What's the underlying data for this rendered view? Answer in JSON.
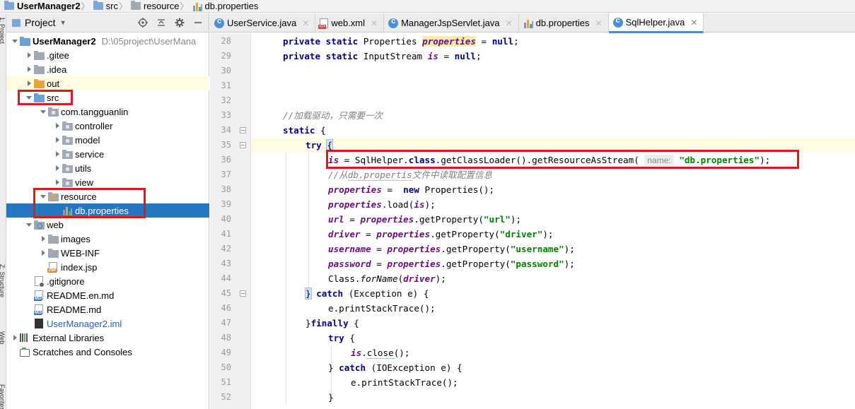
{
  "breadcrumb": {
    "items": [
      {
        "label": "UserManager2",
        "icon": "project-folder-icon",
        "bold": true
      },
      {
        "label": "src",
        "icon": "folder-icon"
      },
      {
        "label": "resource",
        "icon": "resource-folder-icon"
      },
      {
        "label": "db.properties",
        "icon": "properties-file-icon"
      }
    ]
  },
  "left_strip": {
    "labels": [
      "1: Project",
      "Z: Structure",
      "Web",
      "Favorites"
    ]
  },
  "project_panel": {
    "title": "Project",
    "tree": [
      {
        "label": "UserManager2",
        "path": "D:\\05project\\UserMana",
        "depth": 0,
        "state": "open",
        "icon": "module",
        "bold": true
      },
      {
        "label": ".gitee",
        "depth": 1,
        "state": "closed",
        "icon": "folder"
      },
      {
        "label": ".idea",
        "depth": 1,
        "state": "closed",
        "icon": "folder"
      },
      {
        "label": "out",
        "depth": 1,
        "state": "closed",
        "icon": "folder-orange",
        "highlight": true
      },
      {
        "label": "src",
        "depth": 1,
        "state": "open",
        "icon": "folder-src"
      },
      {
        "label": "com.tangguanlin",
        "depth": 2,
        "state": "open",
        "icon": "package"
      },
      {
        "label": "controller",
        "depth": 3,
        "state": "closed",
        "icon": "package"
      },
      {
        "label": "model",
        "depth": 3,
        "state": "closed",
        "icon": "package"
      },
      {
        "label": "service",
        "depth": 3,
        "state": "closed",
        "icon": "package"
      },
      {
        "label": "utils",
        "depth": 3,
        "state": "closed",
        "icon": "package"
      },
      {
        "label": "view",
        "depth": 3,
        "state": "closed",
        "icon": "package"
      },
      {
        "label": "resource",
        "depth": 2,
        "state": "open",
        "icon": "resource"
      },
      {
        "label": "db.properties",
        "depth": 3,
        "state": "none",
        "icon": "properties",
        "selected": true
      },
      {
        "label": "web",
        "depth": 1,
        "state": "open",
        "icon": "web"
      },
      {
        "label": "images",
        "depth": 2,
        "state": "closed",
        "icon": "folder"
      },
      {
        "label": "WEB-INF",
        "depth": 2,
        "state": "closed",
        "icon": "folder"
      },
      {
        "label": "index.jsp",
        "depth": 2,
        "state": "none",
        "icon": "jsp"
      },
      {
        "label": ".gitignore",
        "depth": 1,
        "state": "none",
        "icon": "gitignore"
      },
      {
        "label": "README.en.md",
        "depth": 1,
        "state": "none",
        "icon": "md"
      },
      {
        "label": "README.md",
        "depth": 1,
        "state": "none",
        "icon": "md"
      },
      {
        "label": "UserManager2.iml",
        "depth": 1,
        "state": "none",
        "icon": "iml",
        "blue": true
      },
      {
        "label": "External Libraries",
        "depth": 0,
        "state": "closed",
        "icon": "libraries"
      },
      {
        "label": "Scratches and Consoles",
        "depth": 0,
        "state": "none",
        "icon": "scratches"
      }
    ]
  },
  "editor": {
    "tabs": [
      {
        "label": "UserService.java",
        "icon": "java-class-icon",
        "active": false
      },
      {
        "label": "web.xml",
        "icon": "xml-file-icon",
        "active": false
      },
      {
        "label": "ManagerJspServlet.java",
        "icon": "java-class-icon",
        "active": false
      },
      {
        "label": "db.properties",
        "icon": "properties-file-icon",
        "active": false
      },
      {
        "label": "SqlHelper.java",
        "icon": "java-class-icon",
        "active": true
      }
    ],
    "param_hint": "name:",
    "lines": [
      {
        "n": "28",
        "indent": 1,
        "tokens": [
          [
            "kw",
            "private static "
          ],
          [
            "",
            "Properties "
          ],
          [
            "fld hl",
            "properties"
          ],
          [
            "",
            " = "
          ],
          [
            "kw",
            "null"
          ],
          [
            "",
            ";"
          ]
        ]
      },
      {
        "n": "29",
        "indent": 1,
        "tokens": [
          [
            "kw",
            "private static "
          ],
          [
            "",
            "InputStream "
          ],
          [
            "fld",
            "is"
          ],
          [
            "",
            " = "
          ],
          [
            "kw",
            "null"
          ],
          [
            "",
            ";"
          ]
        ]
      },
      {
        "n": "30",
        "indent": 0,
        "tokens": []
      },
      {
        "n": "31",
        "indent": 0,
        "tokens": []
      },
      {
        "n": "32",
        "indent": 0,
        "tokens": []
      },
      {
        "n": "33",
        "indent": 1,
        "tokens": [
          [
            "cm",
            "//加载驱动，只需要一次"
          ]
        ]
      },
      {
        "n": "34",
        "indent": 1,
        "tokens": [
          [
            "kw",
            "static "
          ],
          [
            "",
            "{"
          ]
        ]
      },
      {
        "n": "35",
        "indent": 2,
        "current": true,
        "tokens": [
          [
            "kw",
            "try "
          ],
          [
            "brace",
            "{"
          ]
        ]
      },
      {
        "n": "36",
        "indent": 3,
        "tokens": [
          [
            "fld",
            "is"
          ],
          [
            "",
            " = SqlHelper."
          ],
          [
            "kw",
            "class"
          ],
          [
            "",
            ".getClassLoader().getResourceAsStream( "
          ],
          [
            "hint",
            "name:"
          ],
          [
            "",
            ""
          ],
          [
            "str",
            " \"db.properties\""
          ],
          [
            "",
            ");"
          ]
        ]
      },
      {
        "n": "37",
        "indent": 3,
        "tokens": [
          [
            "cm",
            "//从"
          ],
          [
            "cm ul",
            "db.propertis"
          ],
          [
            "cm",
            "文件中读取配置信息"
          ]
        ]
      },
      {
        "n": "38",
        "indent": 3,
        "tokens": [
          [
            "fld",
            "properties"
          ],
          [
            "",
            " =  "
          ],
          [
            "kw",
            "new "
          ],
          [
            "",
            "Properties();"
          ]
        ]
      },
      {
        "n": "39",
        "indent": 3,
        "tokens": [
          [
            "fld",
            "properties"
          ],
          [
            "",
            ".load("
          ],
          [
            "fld",
            "is"
          ],
          [
            "",
            ");"
          ]
        ]
      },
      {
        "n": "40",
        "indent": 3,
        "tokens": [
          [
            "fld",
            "url"
          ],
          [
            "",
            " = "
          ],
          [
            "fld",
            "properties"
          ],
          [
            "",
            ".getProperty("
          ],
          [
            "str",
            "\"url\""
          ],
          [
            "",
            ");"
          ]
        ]
      },
      {
        "n": "41",
        "indent": 3,
        "tokens": [
          [
            "fld",
            "driver"
          ],
          [
            "",
            " = "
          ],
          [
            "fld",
            "properties"
          ],
          [
            "",
            ".getProperty("
          ],
          [
            "str",
            "\"driver\""
          ],
          [
            "",
            ");"
          ]
        ]
      },
      {
        "n": "42",
        "indent": 3,
        "tokens": [
          [
            "fld",
            "username"
          ],
          [
            "",
            " = "
          ],
          [
            "fld",
            "properties"
          ],
          [
            "",
            ".getProperty("
          ],
          [
            "str",
            "\"username\""
          ],
          [
            "",
            ");"
          ]
        ]
      },
      {
        "n": "43",
        "indent": 3,
        "tokens": [
          [
            "fld",
            "password"
          ],
          [
            "",
            " = "
          ],
          [
            "fld",
            "properties"
          ],
          [
            "",
            ".getProperty("
          ],
          [
            "str",
            "\"password\""
          ],
          [
            "",
            ");"
          ]
        ]
      },
      {
        "n": "44",
        "indent": 3,
        "tokens": [
          [
            "",
            "Class."
          ],
          [
            "stat",
            "forName"
          ],
          [
            "",
            "("
          ],
          [
            "fld",
            "driver"
          ],
          [
            "",
            ");"
          ]
        ]
      },
      {
        "n": "45",
        "indent": 2,
        "tokens": [
          [
            "brace",
            "}"
          ],
          [
            "",
            " "
          ],
          [
            "kw",
            "catch "
          ],
          [
            "",
            "(Exception e) {"
          ]
        ]
      },
      {
        "n": "46",
        "indent": 3,
        "tokens": [
          [
            "",
            "e.printStackTrace();"
          ]
        ]
      },
      {
        "n": "47",
        "indent": 2,
        "tokens": [
          [
            "",
            "}"
          ],
          [
            "kw",
            "finally "
          ],
          [
            "",
            "{"
          ]
        ]
      },
      {
        "n": "48",
        "indent": 3,
        "tokens": [
          [
            "kw",
            "try "
          ],
          [
            "",
            "{"
          ]
        ]
      },
      {
        "n": "49",
        "indent": 4,
        "tokens": [
          [
            "fld",
            "is"
          ],
          [
            "",
            "."
          ],
          [
            "ul",
            "close"
          ],
          [
            "",
            "();"
          ]
        ]
      },
      {
        "n": "50",
        "indent": 3,
        "tokens": [
          [
            "",
            "} "
          ],
          [
            "kw",
            "catch "
          ],
          [
            "",
            "(IOException e) {"
          ]
        ]
      },
      {
        "n": "51",
        "indent": 4,
        "tokens": [
          [
            "",
            "e.printStackTrace();"
          ]
        ]
      },
      {
        "n": "52",
        "indent": 3,
        "tokens": [
          [
            "",
            "}"
          ]
        ]
      }
    ]
  },
  "colors": {
    "selection": "#2675bf",
    "annotation_red": "#e0161c",
    "keyword": "#000080",
    "field": "#660e7a",
    "string": "#008000",
    "comment": "#808080"
  }
}
